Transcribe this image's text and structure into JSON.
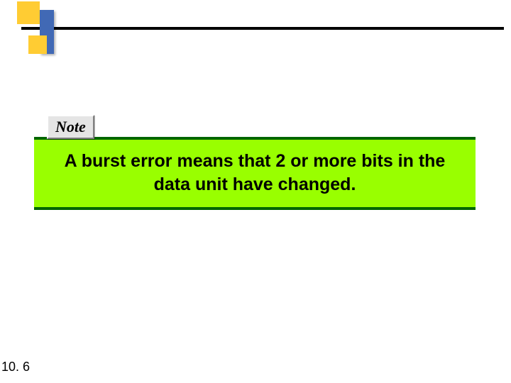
{
  "header": {
    "colors": {
      "yellow": "#ffcc33",
      "blue": "#4169b5",
      "line": "#000000"
    }
  },
  "note": {
    "badge_label": "Note",
    "callout_text": "A burst error means that 2 or more bits in the data unit have changed.",
    "callout_bg": "#99ff00",
    "callout_border": "#006600"
  },
  "footer": {
    "page_number": "10. 6"
  }
}
